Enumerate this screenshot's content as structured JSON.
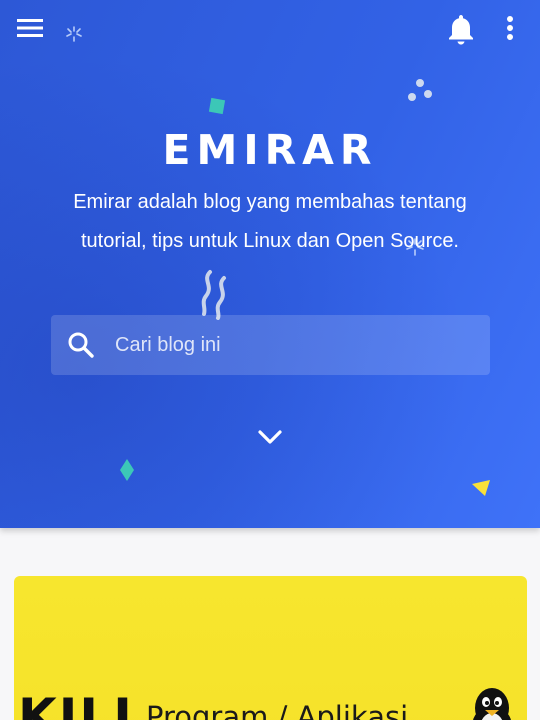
{
  "header": {
    "menu_icon": "hamburger-menu-icon",
    "notification_icon": "bell-icon",
    "more_icon": "more-vertical-icon"
  },
  "hero": {
    "title": "EMIRAR",
    "description": "Emirar adalah blog yang membahas tentang tutorial, tips untuk Linux dan Open Source.",
    "scroll_icon": "chevron-down-icon",
    "colors": {
      "gradient_start": "#2d58d6",
      "gradient_end": "#3f72f8"
    }
  },
  "search": {
    "placeholder": "Cari blog ini",
    "value": "",
    "icon": "search-icon"
  },
  "featured_post": {
    "image_text_main": "KILL",
    "image_text_secondary": "Program / Aplikasi",
    "background_color": "#f6e22a",
    "mascot": "tux-penguin-icon"
  }
}
